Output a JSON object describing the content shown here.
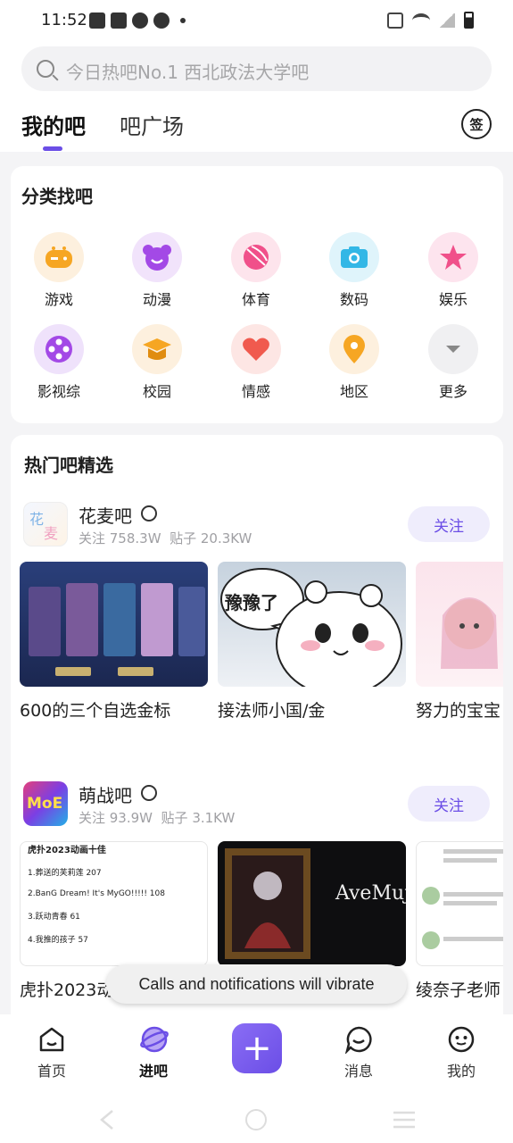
{
  "status_bar": {
    "time": "11:52"
  },
  "search": {
    "placeholder": "今日热吧No.1 西北政法大学吧"
  },
  "tabs": [
    {
      "label": "我的吧",
      "active": true
    },
    {
      "label": "吧广场",
      "active": false
    }
  ],
  "sign_button": {
    "label": "签"
  },
  "categories": {
    "title": "分类找吧",
    "items": [
      {
        "label": "游戏",
        "icon": "gamepad-icon",
        "bg": "#fdf0de",
        "fg": "#f6a623"
      },
      {
        "label": "动漫",
        "icon": "bear-icon",
        "bg": "#f1e3fb",
        "fg": "#a349e6"
      },
      {
        "label": "体育",
        "icon": "ball-icon",
        "bg": "#fde4ec",
        "fg": "#f0508a"
      },
      {
        "label": "数码",
        "icon": "camera-icon",
        "bg": "#dff4fb",
        "fg": "#33b7e6"
      },
      {
        "label": "娱乐",
        "icon": "star-icon",
        "bg": "#fde4ee",
        "fg": "#f0508a"
      },
      {
        "label": "影视综",
        "icon": "film-reel-icon",
        "bg": "#efe2fb",
        "fg": "#a349e6"
      },
      {
        "label": "校园",
        "icon": "graduation-cap-icon",
        "bg": "#fdf0de",
        "fg": "#f6a623"
      },
      {
        "label": "情感",
        "icon": "heart-icon",
        "bg": "#fde6e4",
        "fg": "#f05a4e"
      },
      {
        "label": "地区",
        "icon": "location-pin-icon",
        "bg": "#fdf0de",
        "fg": "#f6a623"
      },
      {
        "label": "更多",
        "icon": "chevron-down-icon",
        "bg": "#f0f0f2",
        "fg": "#888888"
      }
    ]
  },
  "hot": {
    "title": "热门吧精选",
    "bars": [
      {
        "name": "花麦吧",
        "followers": "关注 758.3W",
        "posts_count": "贴子 20.3KW",
        "follow_label": "关注",
        "posts": [
          {
            "caption": "600的三个自选金标"
          },
          {
            "caption": "接法师小国/金",
            "image_text": "豫豫了"
          },
          {
            "caption": "努力的宝宝"
          }
        ]
      },
      {
        "name": "萌战吧",
        "followers": "关注 93.9W",
        "posts_count": "贴子 3.1KW",
        "follow_label": "关注",
        "posts": [
          {
            "caption": "虎扑2023动",
            "image_lines": [
              "虎扑2023动画十佳",
              "1.葬送的芙莉莲 207",
              "2.BanG Dream! It's MyGO!!!!! 108",
              "3.跃动青春 61",
              "4.我推的孩子 57"
            ]
          },
          {
            "caption": "",
            "image_text": "AveMuj"
          },
          {
            "caption": "绫奈子老师"
          }
        ]
      }
    ]
  },
  "toast": {
    "text": "Calls and notifications will vibrate"
  },
  "bottom_nav": [
    {
      "label": "首页",
      "icon": "home-icon"
    },
    {
      "label": "进吧",
      "icon": "planet-icon",
      "active": true
    },
    {
      "label": "",
      "icon": "plus-icon"
    },
    {
      "label": "消息",
      "icon": "message-icon"
    },
    {
      "label": "我的",
      "icon": "profile-icon"
    }
  ],
  "colors": {
    "accent": "#6b4ee6"
  }
}
